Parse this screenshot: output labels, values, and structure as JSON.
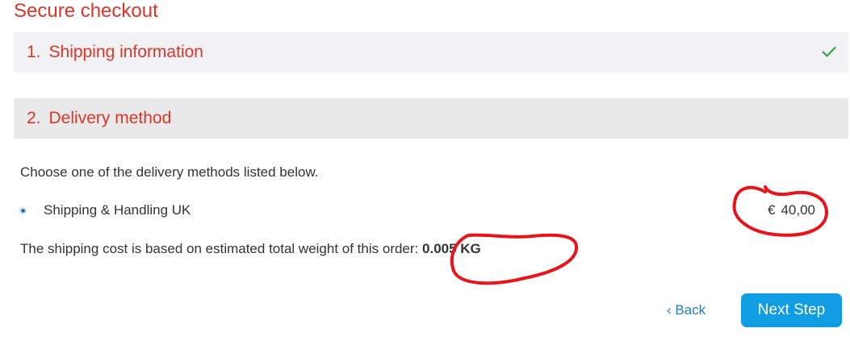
{
  "page": {
    "title": "Secure checkout"
  },
  "steps": [
    {
      "number": "1.",
      "label": "Shipping information",
      "completed_icon": "check-icon"
    },
    {
      "number": "2.",
      "label": "Delivery method"
    }
  ],
  "delivery": {
    "intro": "Choose one of the delivery methods listed below.",
    "methods": [
      {
        "label": "Shipping & Handling UK",
        "currency": "€",
        "price": "40,00",
        "selected": true
      }
    ],
    "weight_note": "The shipping cost is based on estimated total weight of this order:",
    "weight_value": "0.005 KG"
  },
  "actions": {
    "back_label": "‹ Back",
    "next_label": "Next Step"
  },
  "colors": {
    "accent": "#d9362c",
    "primary_button": "#0e9ce2",
    "link": "#1f7fbe",
    "check": "#2e9c3a",
    "annotation": "#e8141c"
  }
}
